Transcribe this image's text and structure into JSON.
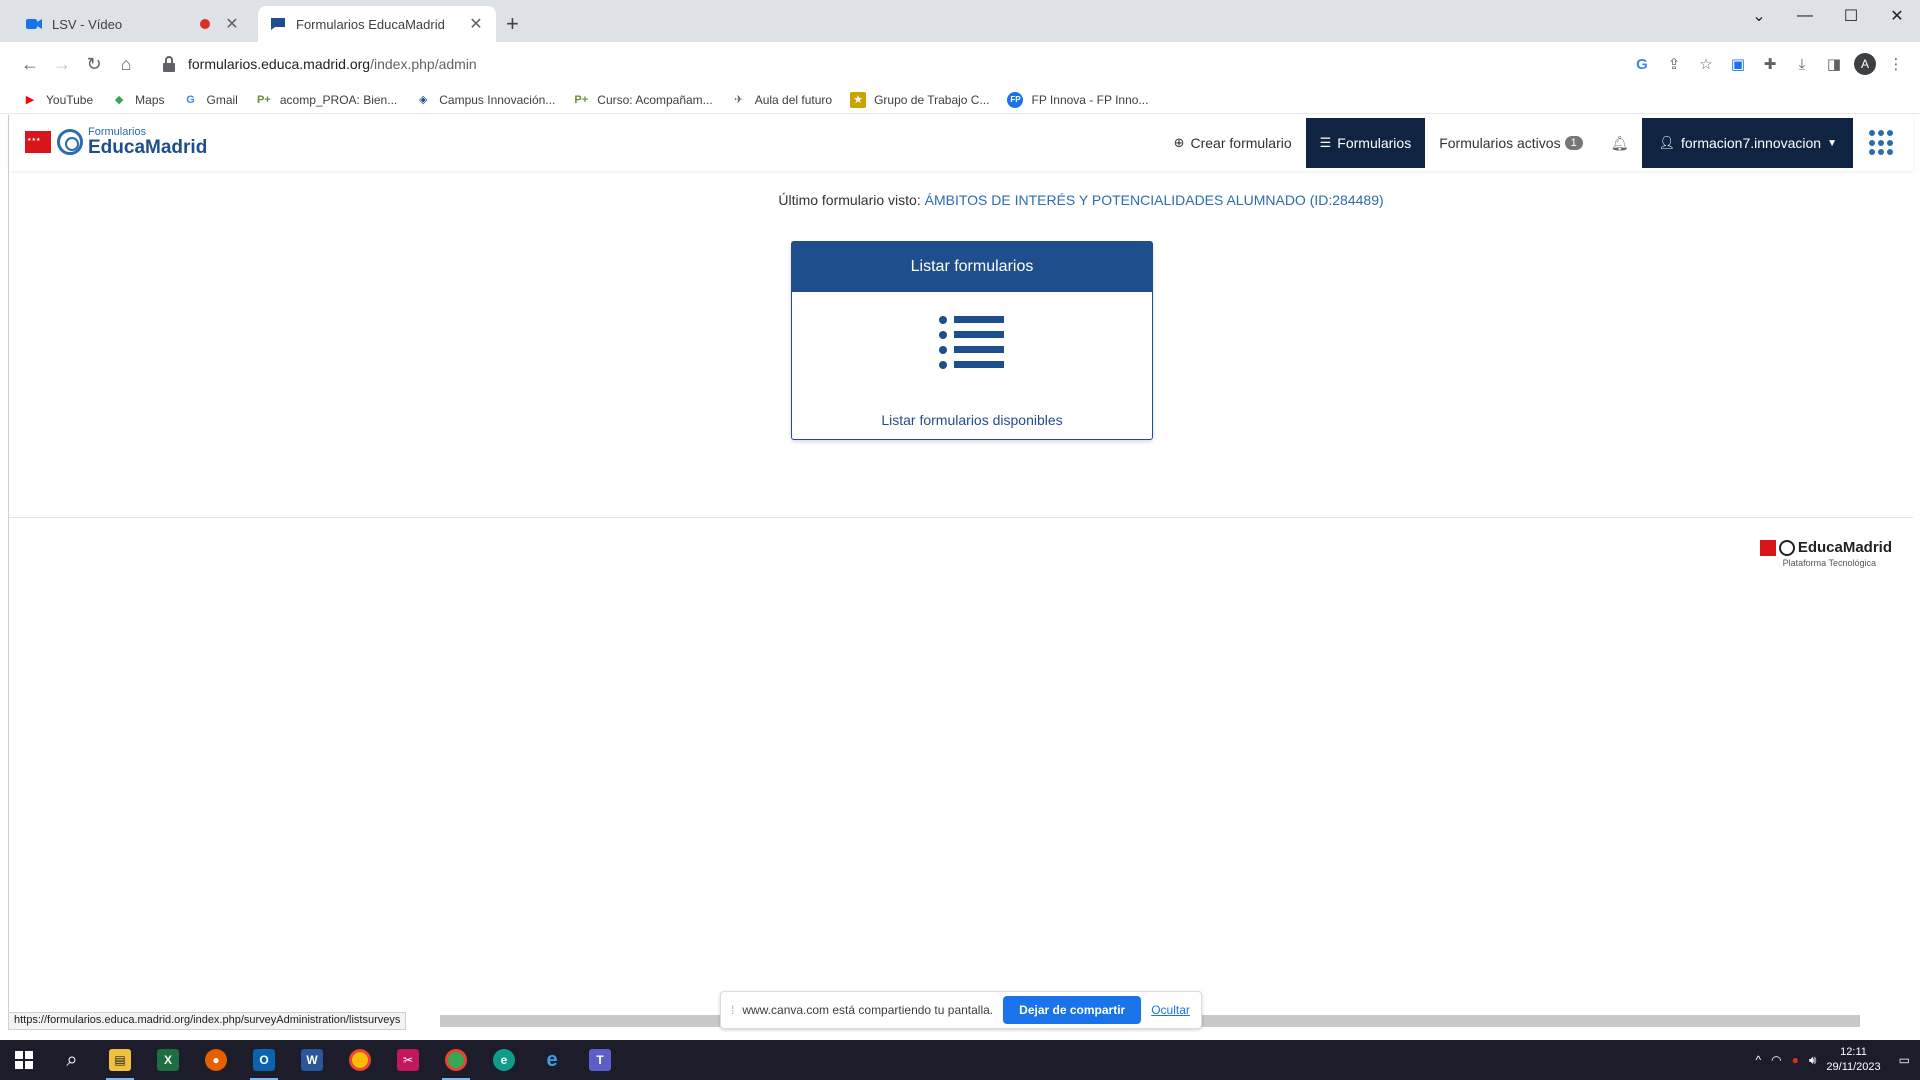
{
  "browser": {
    "tabs": [
      {
        "title": "LSV - Vídeo",
        "active": false,
        "recording": true
      },
      {
        "title": "Formularios EducaMadrid",
        "active": true,
        "recording": false
      }
    ],
    "url_host": "formularios.educa.madrid.org",
    "url_path": "/index.php/admin",
    "avatar_letter": "A",
    "bookmarks": [
      {
        "label": "YouTube",
        "icon": "youtube-icon",
        "color": "#ff0000"
      },
      {
        "label": "Maps",
        "icon": "maps-icon",
        "color": "#34a853"
      },
      {
        "label": "Gmail",
        "icon": "google-icon",
        "color": "#4285f4"
      },
      {
        "label": "acomp_PROA: Bien...",
        "icon": "proa-icon",
        "color": "#6a8f3a"
      },
      {
        "label": "Campus Innovación...",
        "icon": "campus-icon",
        "color": "#1f4e8c"
      },
      {
        "label": "Curso: Acompañam...",
        "icon": "proa-icon",
        "color": "#6a8f3a"
      },
      {
        "label": "Aula del futuro",
        "icon": "aula-icon",
        "color": "#666666"
      },
      {
        "label": "Grupo de Trabajo C...",
        "icon": "grupo-icon",
        "color": "#c9a400"
      },
      {
        "label": "FP Innova - FP Inno...",
        "icon": "fp-icon",
        "color": "#1a73e8"
      }
    ]
  },
  "app": {
    "brand_small": "Formularios",
    "brand_big": "EducaMadrid",
    "nav": {
      "create": "Crear formulario",
      "forms": "Formularios",
      "active_forms": "Formularios activos",
      "active_count": "1",
      "user": "formacion7.innovacion"
    },
    "last_form_label": "Último formulario visto:",
    "last_form_link": "ÁMBITOS DE INTERÉS Y POTENCIALIDADES ALUMNADO (ID:284489)",
    "card": {
      "title": "Listar formularios",
      "link": "Listar formularios disponibles"
    },
    "footer": {
      "name": "EducaMadrid",
      "subtitle": "Plataforma Tecnológica"
    }
  },
  "status_url": "https://formularios.educa.madrid.org/index.php/surveyAdministration/listsurveys",
  "share_bar": {
    "message": "www.canva.com está compartiendo tu pantalla.",
    "stop_label": "Dejar de compartir",
    "hide_label": "Ocultar"
  },
  "taskbar": {
    "time": "12:11",
    "date": "29/11/2023"
  },
  "colors": {
    "brand_blue": "#1f4e8c",
    "nav_dark": "#0f2440",
    "link_blue": "#2b6cb0",
    "share_blue": "#1a73e8"
  }
}
